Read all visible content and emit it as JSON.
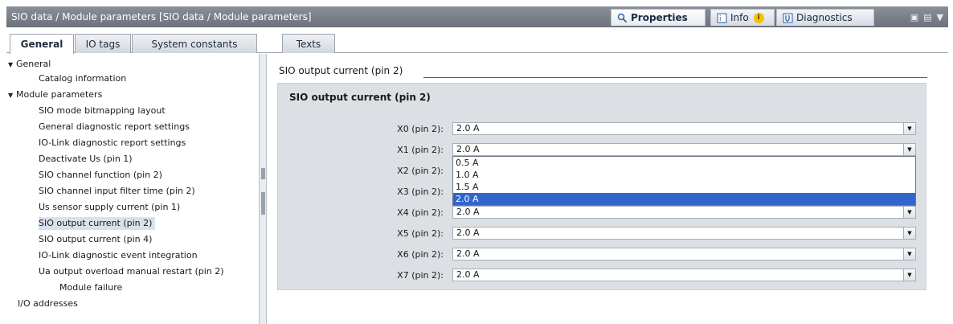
{
  "window": {
    "title": "SIO data / Module parameters [SIO data / Module parameters]",
    "right_tabs": [
      {
        "label": "Properties",
        "icon": "properties-icon"
      },
      {
        "label": "Info",
        "icon": "info-icon"
      },
      {
        "label": "Diagnostics",
        "icon": "diagnostics-icon"
      }
    ]
  },
  "tabs": [
    "General",
    "IO tags",
    "System constants",
    "Texts"
  ],
  "tree": [
    {
      "label": "General",
      "expanded": true
    },
    {
      "label": "Catalog information"
    },
    {
      "label": "Module parameters",
      "expanded": true
    },
    {
      "label": "SIO mode bitmapping layout"
    },
    {
      "label": "General diagnostic report settings"
    },
    {
      "label": "IO-Link diagnostic report settings"
    },
    {
      "label": "Deactivate Us (pin 1)"
    },
    {
      "label": "SIO channel function (pin 2)"
    },
    {
      "label": "SIO channel input filter time (pin 2)"
    },
    {
      "label": "Us sensor supply current (pin 1)"
    },
    {
      "label": "SIO output current (pin 2)",
      "selected": true
    },
    {
      "label": "SIO output current (pin 4)"
    },
    {
      "label": "IO-Link diagnostic event integration"
    },
    {
      "label": "Ua output overload manual restart (pin 2)"
    },
    {
      "label": "Module failure"
    },
    {
      "label": "I/O addresses"
    }
  ],
  "main": {
    "section_header": "SIO output current (pin 2)",
    "group_title": "SIO output current (pin 2)",
    "fields": [
      {
        "label": "X0 (pin 2):",
        "value": "2.0 A"
      },
      {
        "label": "X1 (pin 2):",
        "value": "2.0 A"
      },
      {
        "label": "X2 (pin 2):",
        "value": ""
      },
      {
        "label": "X3 (pin 2):",
        "value": ""
      },
      {
        "label": "X4 (pin 2):",
        "value": "2.0 A"
      },
      {
        "label": "X5 (pin 2):",
        "value": "2.0 A"
      },
      {
        "label": "X6 (pin 2):",
        "value": "2.0 A"
      },
      {
        "label": "X7 (pin 2):",
        "value": "2.0 A"
      }
    ],
    "dropdown_options": [
      "0.5 A",
      "1.0 A",
      "1.5 A",
      "2.0 A"
    ],
    "dropdown_selected": "2.0 A"
  },
  "colors": {
    "selection": "#3366cc",
    "group_bg": "#dcdfe3",
    "titlebar": "#7a808a"
  }
}
